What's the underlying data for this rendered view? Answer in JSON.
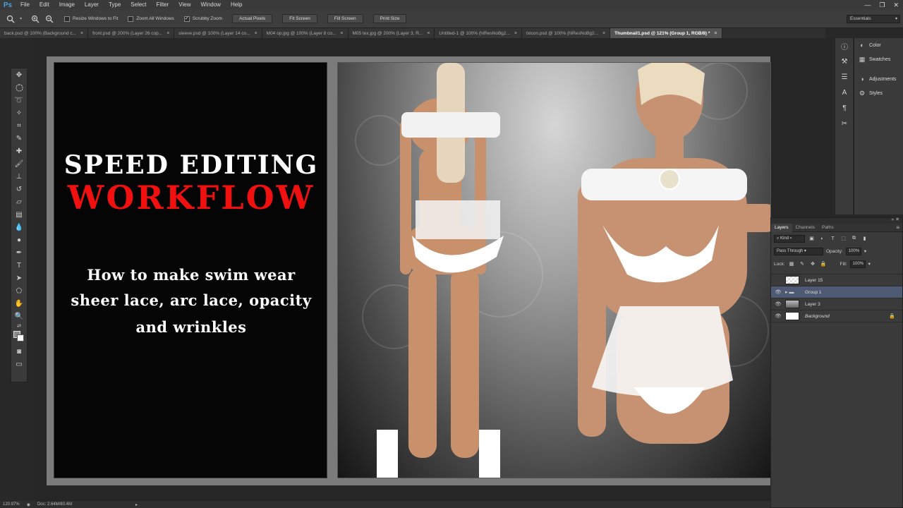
{
  "app": {
    "logo": "Ps"
  },
  "menu": [
    "File",
    "Edit",
    "Image",
    "Layer",
    "Type",
    "Select",
    "Filter",
    "View",
    "Window",
    "Help"
  ],
  "window_controls": [
    "—",
    "❐",
    "✕"
  ],
  "options_bar": {
    "checkboxes": [
      {
        "label": "Resize Windows to Fit",
        "checked": false
      },
      {
        "label": "Zoom All Windows",
        "checked": false
      },
      {
        "label": "Scrubby Zoom",
        "checked": true
      }
    ],
    "buttons": [
      "Actual Pixels",
      "Fit Screen",
      "Fill Screen",
      "Print Size"
    ],
    "workspace": "Essentials"
  },
  "doc_tabs": [
    {
      "label": "back.psd @ 100% (Background c...",
      "active": false
    },
    {
      "label": "front.psd @ 200% (Layer 26 cop...",
      "active": false
    },
    {
      "label": "sleeve.psd @ 100% (Layer 14 co...",
      "active": false
    },
    {
      "label": "M04 op.jpg @ 100% (Layer 8 co...",
      "active": false
    },
    {
      "label": "M05 tex.jpg @ 200% (Layer 3, R...",
      "active": false
    },
    {
      "label": "Untitled-1 @ 100% (hiResNoBg2...",
      "active": false
    },
    {
      "label": "txicon.psd @ 100% (hiResNoBg2...",
      "active": false
    },
    {
      "label": "Thumbnail1.psd @ 121% (Group 1, RGB/8) *",
      "active": true
    }
  ],
  "canvas": {
    "title_line1": "SPEED EDITING",
    "title_line2": "WORKFLOW",
    "subtitle_line1": "How to make swim wear",
    "subtitle_line2": "sheer lace, arc lace, opacity",
    "subtitle_line3": "and wrinkles"
  },
  "side_panels": [
    "Color",
    "Swatches",
    "Adjustments",
    "Styles"
  ],
  "layers_panel": {
    "tabs": [
      "Layers",
      "Channels",
      "Paths"
    ],
    "filter_kind": "Kind",
    "blend_mode": "Pass Through",
    "opacity_label": "Opacity:",
    "opacity_value": "100%",
    "lock_label": "Lock:",
    "fill_label": "Fill:",
    "fill_value": "100%",
    "layers": [
      {
        "name": "Layer 15",
        "visible": false,
        "selected": false
      },
      {
        "name": "Group 1",
        "visible": true,
        "selected": true
      },
      {
        "name": "Layer 3",
        "visible": true,
        "selected": false
      },
      {
        "name": "Background",
        "visible": true,
        "selected": false,
        "locked": true
      }
    ]
  },
  "status": {
    "zoom": "120.97%",
    "doc": "Doc: 2.64M/80.4M"
  },
  "colors": {
    "title_red": "#f01010",
    "selected_layer": "#4e5a73",
    "ps_blue": "#4aa3df"
  }
}
